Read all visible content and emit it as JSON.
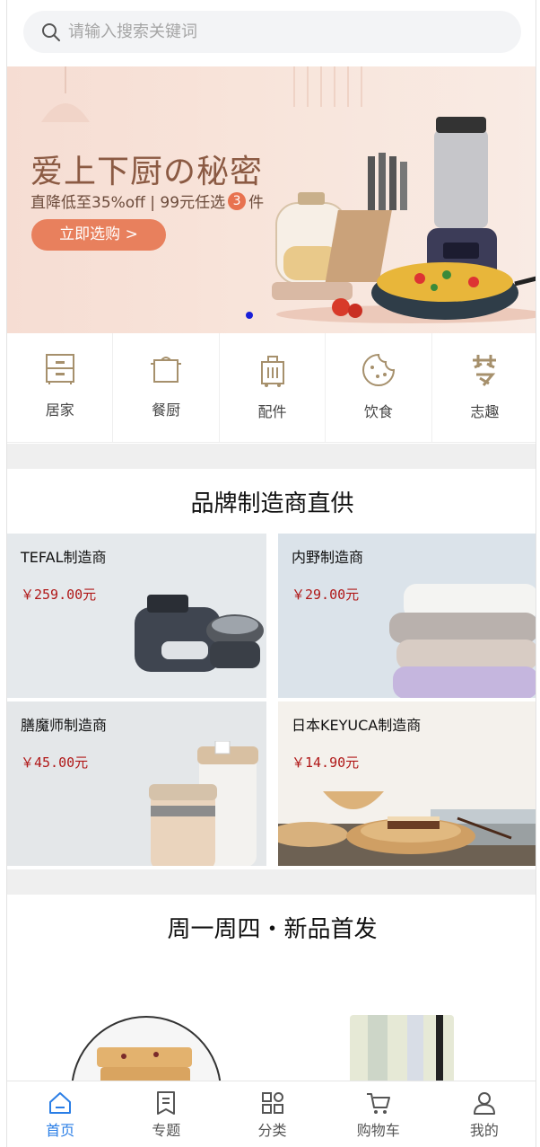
{
  "search": {
    "placeholder": "请输入搜索关键词"
  },
  "banner": {
    "title": "爱上下厨の秘密",
    "subtitle_pre": "直降低至35%off | 99元任选",
    "subtitle_num": "3",
    "subtitle_post": "件",
    "button": "立即选购 >"
  },
  "categories": [
    {
      "label": "居家",
      "icon": "cabinet-icon"
    },
    {
      "label": "餐厨",
      "icon": "pot-icon"
    },
    {
      "label": "配件",
      "icon": "luggage-icon"
    },
    {
      "label": "饮食",
      "icon": "cookie-icon"
    },
    {
      "label": "志趣",
      "icon": "hobby-icon"
    }
  ],
  "brand_section": {
    "title": "品牌制造商直供",
    "items": [
      {
        "name": "TEFAL制造商",
        "price": "￥259.00元"
      },
      {
        "name": "内野制造商",
        "price": "￥29.00元"
      },
      {
        "name": "膳魔师制造商",
        "price": "￥45.00元"
      },
      {
        "name": "日本KEYUCA制造商",
        "price": "￥14.90元"
      }
    ]
  },
  "new_section": {
    "title": "周一周四・新品首发"
  },
  "tabbar": [
    {
      "label": "首页",
      "icon": "home-icon",
      "active": true
    },
    {
      "label": "专题",
      "icon": "bookmark-icon",
      "active": false
    },
    {
      "label": "分类",
      "icon": "grid-icon",
      "active": false
    },
    {
      "label": "购物车",
      "icon": "cart-icon",
      "active": false
    },
    {
      "label": "我的",
      "icon": "user-icon",
      "active": false
    }
  ],
  "colors": {
    "accent": "#2a7ee6",
    "price": "#b01818",
    "banner_button": "#e8805d"
  }
}
